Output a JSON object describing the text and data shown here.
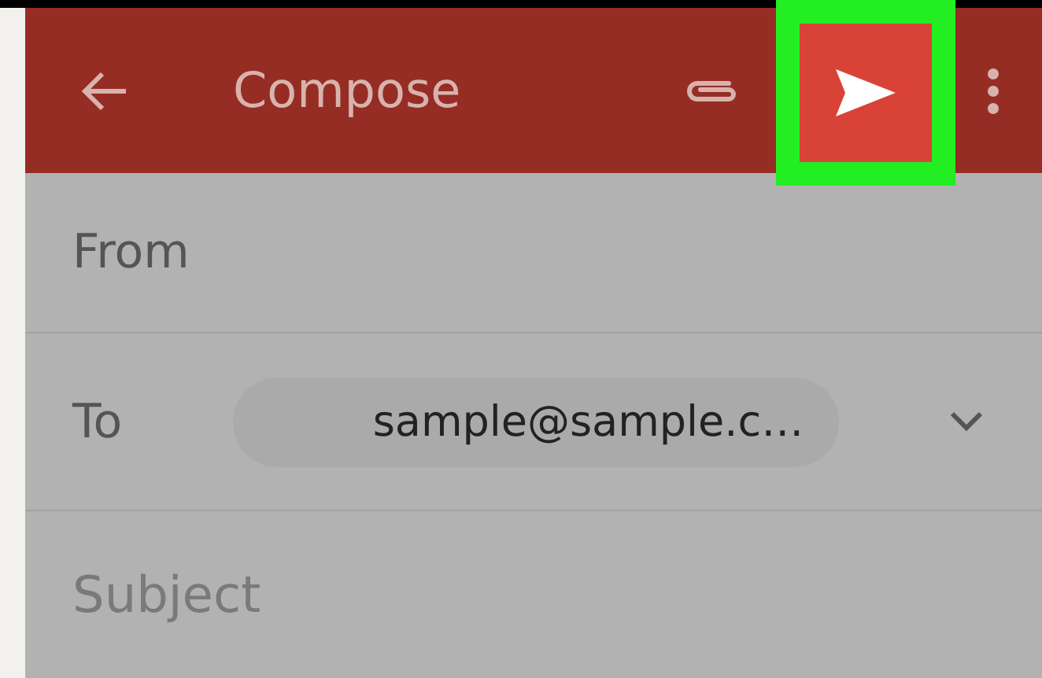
{
  "toolbar": {
    "title": "Compose",
    "send_highlighted": true
  },
  "from": {
    "label": "From"
  },
  "to": {
    "label": "To",
    "recipient": "sample@sample.c…"
  },
  "subject": {
    "placeholder": "Subject"
  }
}
